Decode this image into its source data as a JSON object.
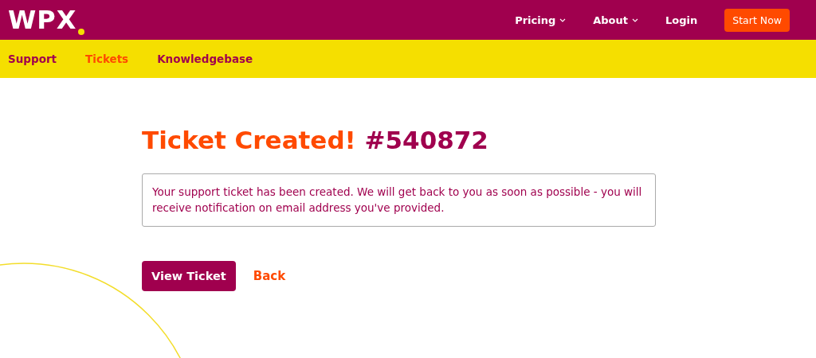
{
  "header": {
    "logo": "WPX",
    "nav": [
      {
        "label": "Pricing",
        "kind": "dropdown"
      },
      {
        "label": "About",
        "kind": "dropdown"
      },
      {
        "label": "Login",
        "kind": "link"
      }
    ],
    "cta": "Start Now"
  },
  "subnav": [
    {
      "label": "Support",
      "selected": false
    },
    {
      "label": "Tickets",
      "selected": true
    },
    {
      "label": "Knowledgebase",
      "selected": false
    }
  ],
  "heading": {
    "title": "Ticket Created!",
    "number": "#540872"
  },
  "message": "Your support ticket has been created. We will get back to you as soon as possible - you will receive notification on email address you've provided.",
  "actions": {
    "primary": "View Ticket",
    "secondary": "Back"
  }
}
